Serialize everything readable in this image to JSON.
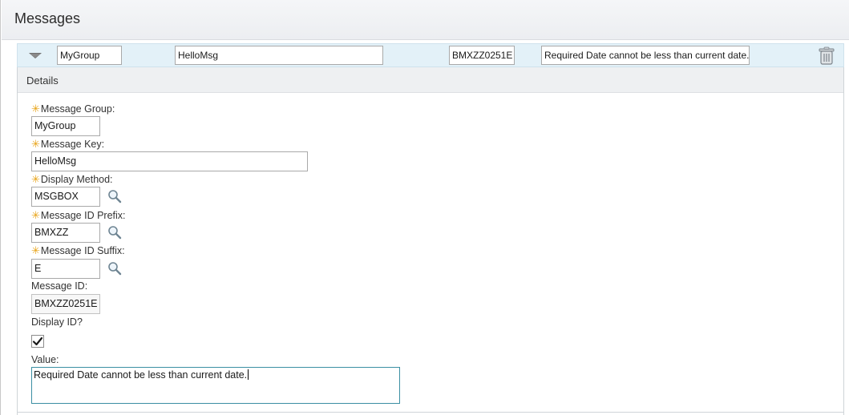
{
  "page": {
    "title": "Messages"
  },
  "row": {
    "group": "MyGroup",
    "key": "HelloMsg",
    "message_id": "BMXZZ0251E",
    "value": "Required Date cannot be less than current date."
  },
  "details": {
    "header": "Details",
    "fields": {
      "message_group": {
        "label": "Message Group:",
        "value": "MyGroup"
      },
      "message_key": {
        "label": "Message Key:",
        "value": "HelloMsg"
      },
      "display_method": {
        "label": "Display Method:",
        "value": "MSGBOX"
      },
      "message_id_prefix": {
        "label": "Message ID Prefix:",
        "value": "BMXZZ"
      },
      "message_id_suffix": {
        "label": "Message ID Suffix:",
        "value": "E"
      },
      "message_id": {
        "label": "Message ID:",
        "value": "BMXZZ0251E"
      },
      "display_id": {
        "label": "Display ID?",
        "checked": true
      },
      "value": {
        "label": "Value:",
        "value": "Required Date cannot be less than current date."
      }
    },
    "required_marker": "✳"
  },
  "icons": {
    "expand": "chevron-down-icon",
    "delete": "trash-icon",
    "lookup": "search-icon"
  },
  "colors": {
    "row_bg": "#e3f1f8",
    "required": "#e8a317",
    "focus_border": "#3b8fa3"
  }
}
